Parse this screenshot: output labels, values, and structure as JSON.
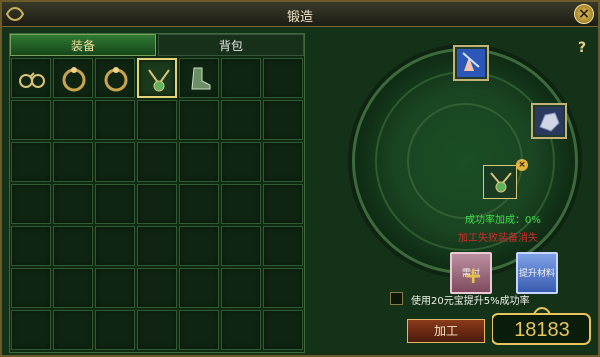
{
  "window": {
    "title": "锻造",
    "close_label": "×"
  },
  "tabs": [
    {
      "label": "装备",
      "active": true
    },
    {
      "label": "背包",
      "active": false
    }
  ],
  "inventory": {
    "items": [
      {
        "icon": "glasses-icon"
      },
      {
        "icon": "ring-icon"
      },
      {
        "icon": "ring-icon"
      },
      {
        "icon": "pendant-icon",
        "selected": true
      },
      {
        "icon": "boot-icon"
      }
    ]
  },
  "forge": {
    "help_label": "?",
    "center_remove": "×",
    "success_rate_text": "成功率加成：0%",
    "warning_text": "加工失败装备消失",
    "red_box_label": "需付",
    "blue_box_label": "提升材料",
    "checkbox_label": "使用20元宝提升5%成功率",
    "action_button": "加工"
  },
  "logo": {
    "text": "18183"
  },
  "colors": {
    "accent_gold": "#e5d37a",
    "success_green": "#3fe24b",
    "warning_red": "#d42b2b"
  }
}
